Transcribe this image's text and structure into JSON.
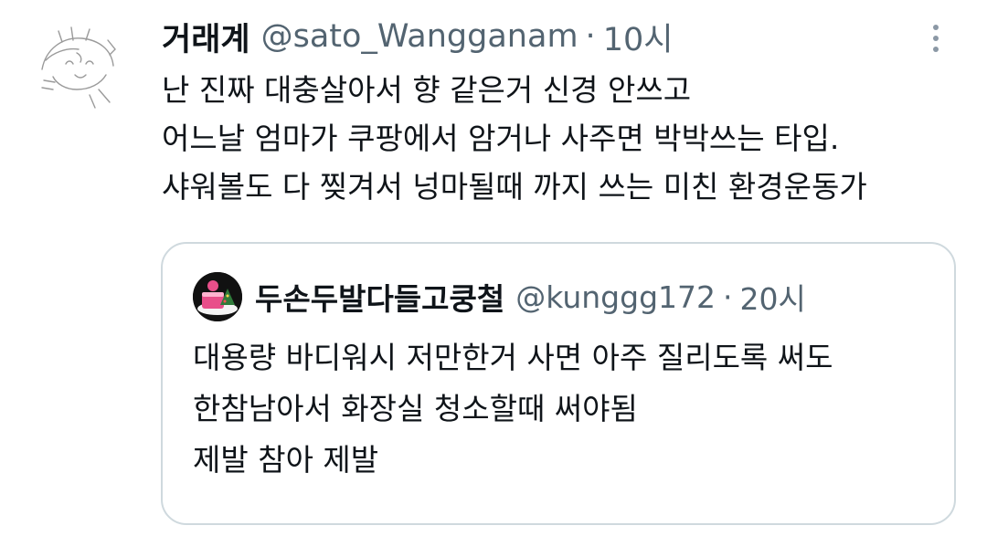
{
  "tweet": {
    "display_name": "거래계",
    "handle": "@sato_Wangganam",
    "separator": "·",
    "time": "10시",
    "lines": [
      "난 진짜 대충살아서 향 같은거 신경 안쓰고",
      "어느날 엄마가 쿠팡에서 암거나 사주면 박박쓰는 타입.",
      "샤워볼도 다 찢겨서 넝마될때 까지 쓰는 미친 환경운동가"
    ],
    "more_icon": "more-vertical-icon"
  },
  "quote": {
    "display_name": "두손두발다들고쿵철",
    "handle": "@kunggg172",
    "separator": "·",
    "time": "20시",
    "lines": [
      "대용량 바디워시 저만한거 사면 아주 질리도록 써도",
      "한참남아서 화장실 청소할때 써야됨",
      "제발 참아 제발"
    ]
  },
  "colors": {
    "text": "#0f1419",
    "secondary": "#536471",
    "border": "#cfd9de"
  }
}
